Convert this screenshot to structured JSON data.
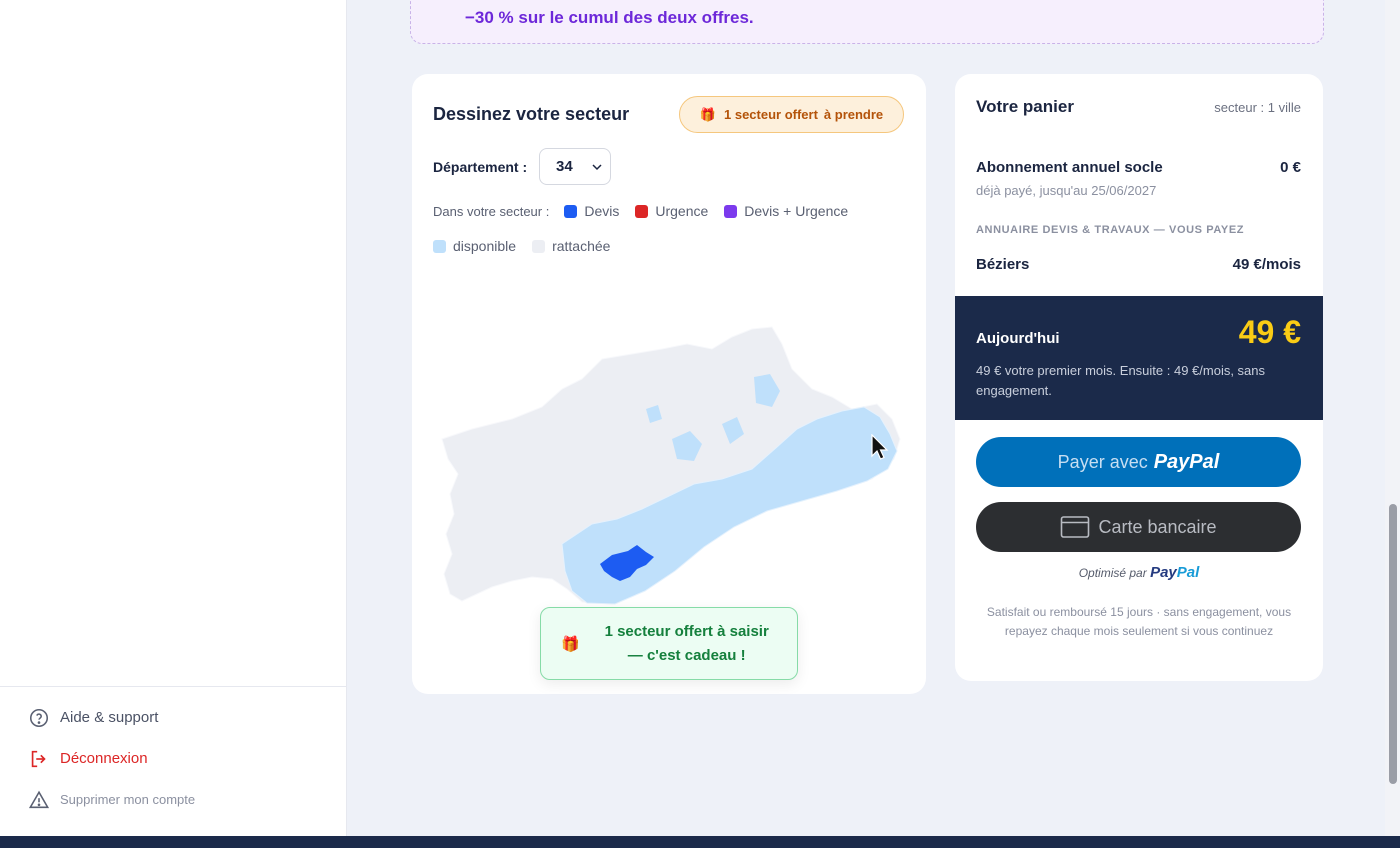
{
  "sidebar": {
    "help": "Aide & support",
    "logout": "Déconnexion",
    "delete_account": "Supprimer mon compte"
  },
  "promo": {
    "text": "−30 % sur le cumul des deux offres."
  },
  "map_card": {
    "title": "Dessinez votre secteur",
    "offer_badge": "1 secteur offert",
    "offer_badge_suffix": "à prendre",
    "department_label": "Département :",
    "department_value": "34",
    "legend_intro": "Dans votre secteur :",
    "legend": [
      {
        "label": "Devis",
        "color": "#1d5cf2"
      },
      {
        "label": "Urgence",
        "color": "#dc2626"
      },
      {
        "label": "Devis + Urgence",
        "color": "#7c3aed"
      },
      {
        "label": "disponible",
        "color": "#bfe0fb"
      },
      {
        "label": "rattachée",
        "color": "#eceef3"
      }
    ],
    "gift_banner_line1": "1 secteur offert à saisir",
    "gift_banner_line2": "— c'est cadeau !"
  },
  "cart": {
    "title": "Votre panier",
    "scope": "secteur : 1 ville",
    "base_label": "Abonnement annuel socle",
    "base_amount": "0 €",
    "base_sub": "déjà payé, jusqu'au 25/06/2027",
    "section_head": "ANNUAIRE DEVIS & TRAVAUX — VOUS PAYEZ",
    "city": "Béziers",
    "city_price": "49 €/mois",
    "today_label": "Aujourd'hui",
    "today_price": "49 €",
    "today_desc": "49 € votre premier mois. Ensuite : 49 €/mois, sans engagement.",
    "paypal_prefix": "Payer avec",
    "paypal_brand": "PayPal",
    "card_label": "Carte bancaire",
    "optimized_prefix": "Optimisé par",
    "optimized_brand_a": "Pay",
    "optimized_brand_b": "Pal",
    "guarantee": "Satisfait ou remboursé 15 jours · sans engagement, vous repayez chaque mois seulement si vous continuez"
  }
}
